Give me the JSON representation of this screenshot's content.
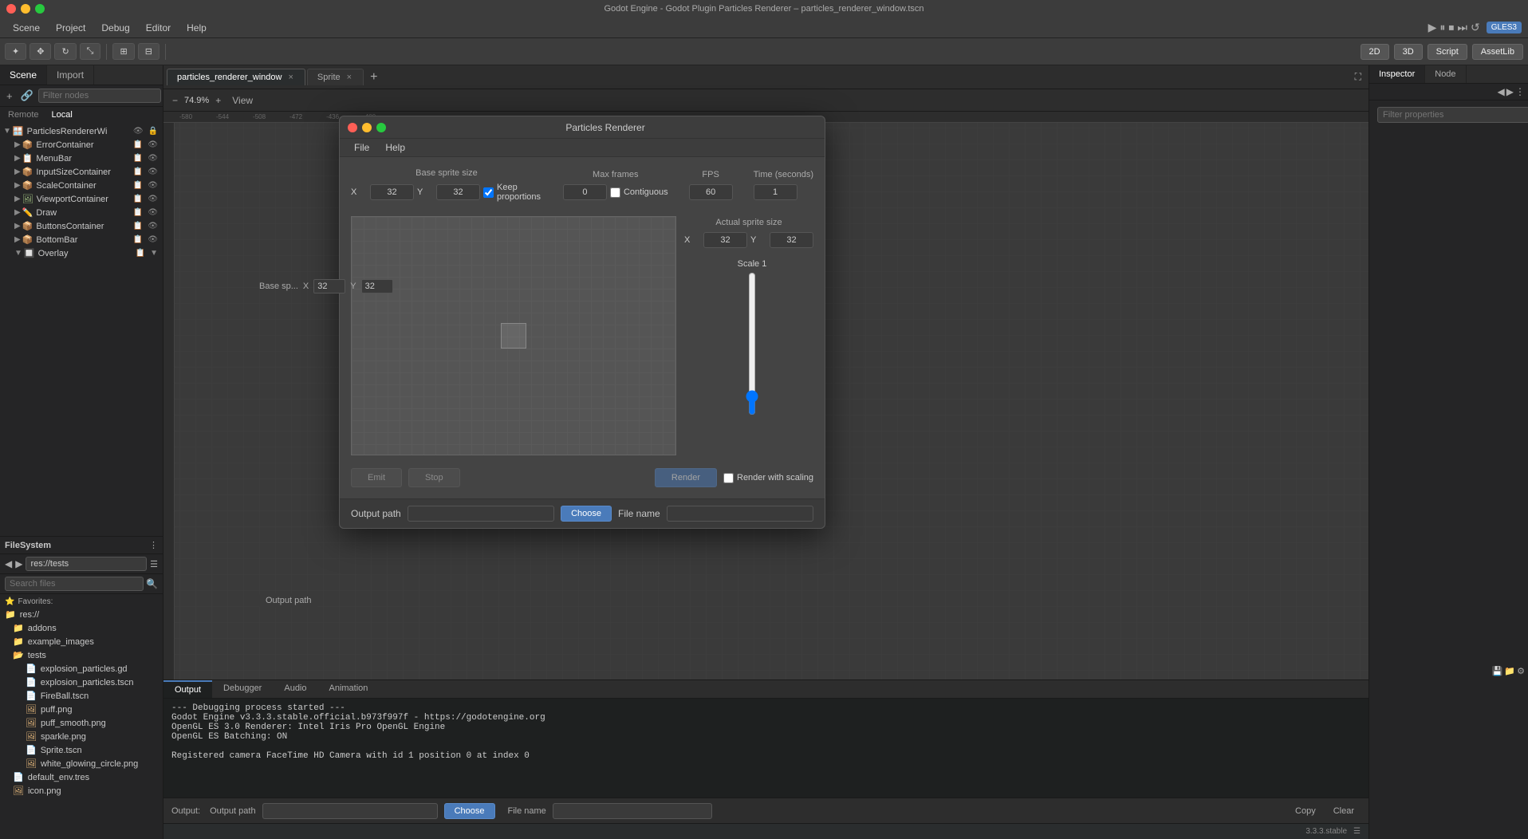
{
  "window": {
    "title": "Godot Engine - Godot Plugin Particles Renderer – particles_renderer_window.tscn",
    "traffic_lights": [
      "close",
      "minimize",
      "maximize"
    ]
  },
  "menu_bar": {
    "items": [
      "Scene",
      "Project",
      "Debug",
      "Editor",
      "Help"
    ]
  },
  "toolbar": {
    "mode_2d": "2D",
    "mode_3d": "3D",
    "mode_script": "Script",
    "mode_assetlib": "AssetLib",
    "gles_badge": "GLES3",
    "view_label": "View"
  },
  "scene_panel": {
    "title": "Scene",
    "tabs": [
      "Scene",
      "Import"
    ],
    "remote_local": [
      "Remote",
      "Local"
    ],
    "filter_placeholder": "Filter nodes",
    "tree_items": [
      {
        "label": "ParticlesRendererWi",
        "depth": 0,
        "expanded": true,
        "icon": "window"
      },
      {
        "label": "ErrorContainer",
        "depth": 1,
        "expanded": false,
        "icon": "container"
      },
      {
        "label": "MenuBar",
        "depth": 1,
        "expanded": false,
        "icon": "menubar"
      },
      {
        "label": "InputSizeContainer",
        "depth": 1,
        "expanded": false,
        "icon": "container"
      },
      {
        "label": "ScaleContainer",
        "depth": 1,
        "expanded": false,
        "icon": "container"
      },
      {
        "label": "ViewportContainer",
        "depth": 1,
        "expanded": false,
        "icon": "viewport"
      },
      {
        "label": "Draw",
        "depth": 1,
        "expanded": false,
        "icon": "draw"
      },
      {
        "label": "ButtonsContainer",
        "depth": 1,
        "expanded": false,
        "icon": "container"
      },
      {
        "label": "BottomBar",
        "depth": 1,
        "expanded": false,
        "icon": "bar"
      },
      {
        "label": "Overlay",
        "depth": 1,
        "expanded": false,
        "icon": "overlay"
      }
    ]
  },
  "filesystem": {
    "title": "FileSystem",
    "path": "res://tests",
    "search_placeholder": "Search files",
    "favorites_label": "Favorites:",
    "items": [
      {
        "label": "res://",
        "type": "folder",
        "depth": 0,
        "expanded": true
      },
      {
        "label": "addons",
        "type": "folder",
        "depth": 1,
        "expanded": false
      },
      {
        "label": "example_images",
        "type": "folder",
        "depth": 1,
        "expanded": false
      },
      {
        "label": "tests",
        "type": "folder",
        "depth": 1,
        "expanded": true
      },
      {
        "label": "explosion_particles.gd",
        "type": "file",
        "depth": 2
      },
      {
        "label": "explosion_particles.tscn",
        "type": "file",
        "depth": 2
      },
      {
        "label": "FireBall.tscn",
        "type": "file",
        "depth": 2
      },
      {
        "label": "puff.png",
        "type": "file",
        "depth": 2
      },
      {
        "label": "puff_smooth.png",
        "type": "file",
        "depth": 2
      },
      {
        "label": "sparkle.png",
        "type": "file",
        "depth": 2
      },
      {
        "label": "Sprite.tscn",
        "type": "file",
        "depth": 2
      },
      {
        "label": "white_glowing_circle.png",
        "type": "file",
        "depth": 2
      },
      {
        "label": "default_env.tres",
        "type": "file",
        "depth": 1
      },
      {
        "label": "icon.png",
        "type": "file",
        "depth": 1
      }
    ]
  },
  "editor_tabs": [
    {
      "label": "particles_renderer_window",
      "active": true,
      "closable": true
    },
    {
      "label": "Sprite",
      "active": false,
      "closable": true
    }
  ],
  "viewport": {
    "zoom": "74.9%",
    "view_label": "View"
  },
  "inspector": {
    "tabs": [
      "Inspector",
      "Node"
    ],
    "filter_placeholder": "Filter properties"
  },
  "particles_dialog": {
    "title": "Particles Renderer",
    "menu": [
      "File",
      "Help"
    ],
    "base_sprite_size": {
      "label": "Base sprite size",
      "x_label": "X",
      "x_value": "32",
      "y_label": "Y",
      "y_value": "32",
      "keep_proportions": true,
      "keep_proportions_label": "Keep proportions"
    },
    "max_frames": {
      "label": "Max frames",
      "value": "0",
      "contiguous_label": "Contiguous"
    },
    "fps": {
      "label": "FPS",
      "value": "60"
    },
    "time_seconds": {
      "label": "Time (seconds)",
      "value": "1"
    },
    "actual_sprite_size": {
      "label": "Actual sprite size",
      "x_label": "X",
      "x_value": "32",
      "y_label": "Y",
      "y_value": "32"
    },
    "scale": {
      "label": "Scale",
      "value": "1"
    },
    "buttons": {
      "emit": "Emit",
      "stop": "Stop",
      "render": "Render",
      "render_with_scaling_label": "Render with scaling"
    },
    "output": {
      "path_label": "Output path",
      "path_value": "",
      "choose_btn": "Choose",
      "file_name_label": "File name",
      "file_name_value": ""
    }
  },
  "output_panel": {
    "tabs": [
      "Output",
      "Debugger",
      "Audio",
      "Animation"
    ],
    "active_tab": "Output",
    "label": "Output:",
    "content": [
      "--- Debugging process started ---",
      "Godot Engine v3.3.3.stable.official.b973f997f - https://godotengine.org",
      "OpenGL ES 3.0 Renderer: Intel Iris Pro OpenGL Engine",
      "OpenGL ES Batching: ON",
      "",
      "Registered camera FaceTime HD Camera with id 1 position 0 at index 0"
    ],
    "output_path_label": "Output path",
    "file_name_label": "File name",
    "choose_btn": "Choose",
    "copy_btn": "Copy",
    "clear_btn": "Clear"
  },
  "status_bar": {
    "version": "3.3.3.stable"
  }
}
